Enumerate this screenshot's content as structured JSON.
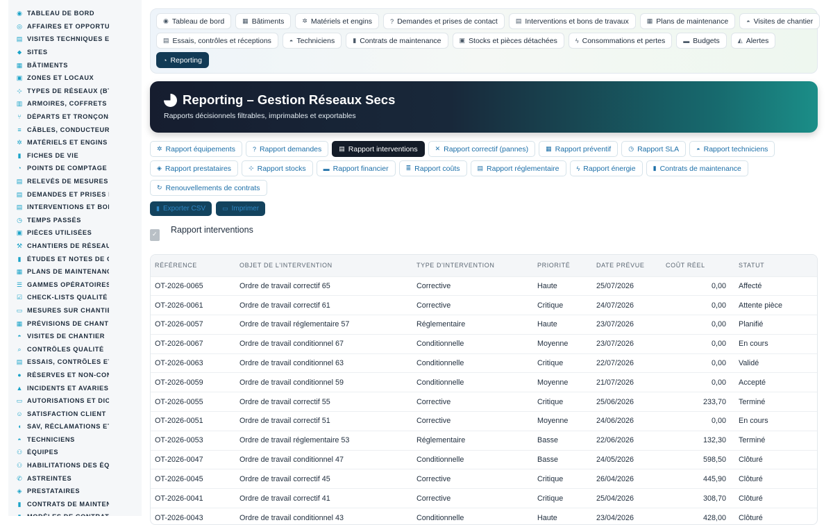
{
  "sidebar": {
    "items": [
      {
        "icon": "dashboard-icon",
        "glyph": "◉",
        "label": "TABLEAU DE BORD"
      },
      {
        "icon": "target-icon",
        "glyph": "◎",
        "label": "AFFAIRES ET OPPORTUNITÉS"
      },
      {
        "icon": "clipboard-icon",
        "glyph": "▤",
        "label": "VISITES TECHNIQUES ET"
      },
      {
        "icon": "location-pin-icon",
        "glyph": "⬥",
        "label": "SITES"
      },
      {
        "icon": "building-icon",
        "glyph": "▦",
        "label": "BÂTIMENTS"
      },
      {
        "icon": "zone-icon",
        "glyph": "▣",
        "label": "ZONES ET LOCAUX"
      },
      {
        "icon": "network-icon",
        "glyph": "⊹",
        "label": "TYPES DE RÉSEAUX (BT / HTA)"
      },
      {
        "icon": "cabinet-icon",
        "glyph": "▥",
        "label": "ARMOIRES, COFFRETS ET"
      },
      {
        "icon": "branch-icon",
        "glyph": "⑂",
        "label": "DÉPARTS ET TRONÇONS"
      },
      {
        "icon": "cable-icon",
        "glyph": "≡",
        "label": "CÂBLES, CONDUCTEURS"
      },
      {
        "icon": "gear-icon",
        "glyph": "✲",
        "label": "MATÉRIELS ET ENGINS"
      },
      {
        "icon": "file-icon",
        "glyph": "▮",
        "label": "FICHES DE VIE"
      },
      {
        "icon": "gauge-icon",
        "glyph": "◔",
        "label": "POINTS DE COMPTAGE ET"
      },
      {
        "icon": "clipboard-check-icon",
        "glyph": "▤",
        "label": "RELEVÉS DE MESURES"
      },
      {
        "icon": "clipboard-icon",
        "glyph": "▤",
        "label": "DEMANDES ET PRISES DE"
      },
      {
        "icon": "clipboard-list-icon",
        "glyph": "▤",
        "label": "INTERVENTIONS ET BONS"
      },
      {
        "icon": "clock-icon",
        "glyph": "◷",
        "label": "TEMPS PASSÉS"
      },
      {
        "icon": "box-icon",
        "glyph": "▣",
        "label": "PIÈCES UTILISÉES"
      },
      {
        "icon": "hammer-icon",
        "glyph": "⚒",
        "label": "CHANTIERS DE RÉSEAUX"
      },
      {
        "icon": "file-lines-icon",
        "glyph": "▮",
        "label": "ÉTUDES ET NOTES DE CALCUL"
      },
      {
        "icon": "calendar-icon",
        "glyph": "▦",
        "label": "PLANS DE MAINTENANCE"
      },
      {
        "icon": "list-icon",
        "glyph": "☰",
        "label": "GAMMES OPÉRATOIRES"
      },
      {
        "icon": "checklist-icon",
        "glyph": "☑",
        "label": "CHECK-LISTS QUALITÉ"
      },
      {
        "icon": "ruler-icon",
        "glyph": "▭",
        "label": "MESURES SUR CHANTIER"
      },
      {
        "icon": "calendar-days-icon",
        "glyph": "▦",
        "label": "PRÉVISIONS DE CHANTIER"
      },
      {
        "icon": "helmet-icon",
        "glyph": "◓",
        "label": "VISITES DE CHANTIER"
      },
      {
        "icon": "search-icon",
        "glyph": "⌕",
        "label": "CONTRÔLES QUALITÉ"
      },
      {
        "icon": "clipboard-check-icon",
        "glyph": "▤",
        "label": "ESSAIS, CONTRÔLES ET"
      },
      {
        "icon": "alert-circle-icon",
        "glyph": "●",
        "label": "RÉSERVES ET NON-CONFORMITÉS"
      },
      {
        "icon": "warning-icon",
        "glyph": "▲",
        "label": "INCIDENTS ET AVARIES"
      },
      {
        "icon": "id-card-icon",
        "glyph": "▭",
        "label": "AUTORISATIONS ET DICT"
      },
      {
        "icon": "smile-icon",
        "glyph": "☺",
        "label": "SATISFACTION CLIENT"
      },
      {
        "icon": "comment-icon",
        "glyph": "◖",
        "label": "SAV, RÉCLAMATIONS ET GARANTIES"
      },
      {
        "icon": "helmet-icon",
        "glyph": "◓",
        "label": "TECHNICIENS"
      },
      {
        "icon": "users-icon",
        "glyph": "⚇",
        "label": "ÉQUIPES"
      },
      {
        "icon": "user-check-icon",
        "glyph": "⚇",
        "label": "HABILITATIONS DES ÉQUIPES"
      },
      {
        "icon": "phone-icon",
        "glyph": "✆",
        "label": "ASTREINTES"
      },
      {
        "icon": "handshake-icon",
        "glyph": "◈",
        "label": "PRESTATAIRES"
      },
      {
        "icon": "file-contract-icon",
        "glyph": "▮",
        "label": "CONTRATS DE MAINTENANCE"
      },
      {
        "icon": "file-icon",
        "glyph": "▮",
        "label": "MODÈLES DE CONTRATS"
      }
    ]
  },
  "topnav": {
    "rows": [
      [
        {
          "icon": "dashboard-icon",
          "glyph": "◉",
          "label": "Tableau de bord"
        },
        {
          "icon": "building-icon",
          "glyph": "▦",
          "label": "Bâtiments"
        },
        {
          "icon": "gear-icon",
          "glyph": "✲",
          "label": "Matériels et engins"
        },
        {
          "icon": "question-icon",
          "glyph": "?",
          "label": "Demandes et prises de contact"
        },
        {
          "icon": "clipboard-icon",
          "glyph": "▤",
          "label": "Interventions et bons de travaux"
        },
        {
          "icon": "calendar-icon",
          "glyph": "▦",
          "label": "Plans de maintenance"
        },
        {
          "icon": "helmet-icon",
          "glyph": "◓",
          "label": "Visites de chantier"
        }
      ],
      [
        {
          "icon": "clipboard-check-icon",
          "glyph": "▤",
          "label": "Essais, contrôles et réceptions"
        },
        {
          "icon": "helmet-icon",
          "glyph": "◓",
          "label": "Techniciens"
        },
        {
          "icon": "file-contract-icon",
          "glyph": "▮",
          "label": "Contrats de maintenance"
        },
        {
          "icon": "boxes-icon",
          "glyph": "▣",
          "label": "Stocks et pièces détachées"
        },
        {
          "icon": "bolt-icon",
          "glyph": "ϟ",
          "label": "Consommations et pertes"
        },
        {
          "icon": "money-icon",
          "glyph": "▬",
          "label": "Budgets"
        },
        {
          "icon": "bell-icon",
          "glyph": "◭",
          "label": "Alertes"
        }
      ],
      [
        {
          "icon": "pie-chart-icon",
          "glyph": "◔",
          "label": "Reporting",
          "active": true
        }
      ]
    ]
  },
  "hero": {
    "title": "Reporting – Gestion Réseaux Secs",
    "subtitle": "Rapports décisionnels filtrables, imprimables et exportables"
  },
  "reports": {
    "rows": [
      [
        {
          "icon": "gears-icon",
          "glyph": "✲",
          "label": "Rapport équipements"
        },
        {
          "icon": "question-icon",
          "glyph": "?",
          "label": "Rapport demandes"
        },
        {
          "icon": "clipboard-icon",
          "glyph": "▤",
          "label": "Rapport interventions",
          "active": true
        },
        {
          "icon": "tools-icon",
          "glyph": "✕",
          "label": "Rapport correctif (pannes)"
        },
        {
          "icon": "calendar-icon",
          "glyph": "▦",
          "label": "Rapport préventif"
        },
        {
          "icon": "stopwatch-icon",
          "glyph": "◷",
          "label": "Rapport SLA"
        },
        {
          "icon": "helmet-icon",
          "glyph": "◓",
          "label": "Rapport techniciens"
        }
      ],
      [
        {
          "icon": "handshake-icon",
          "glyph": "◈",
          "label": "Rapport prestataires"
        },
        {
          "icon": "sitemap-icon",
          "glyph": "⊹",
          "label": "Rapport stocks"
        },
        {
          "icon": "money-icon",
          "glyph": "▬",
          "label": "Rapport financier"
        },
        {
          "icon": "coins-icon",
          "glyph": "≣",
          "label": "Rapport coûts"
        },
        {
          "icon": "clipboard-check-icon",
          "glyph": "▤",
          "label": "Rapport réglementaire"
        },
        {
          "icon": "bolt-icon",
          "glyph": "ϟ",
          "label": "Rapport énergie"
        },
        {
          "icon": "file-contract-icon",
          "glyph": "▮",
          "label": "Contrats de maintenance"
        }
      ],
      [
        {
          "icon": "refresh-icon",
          "glyph": "↻",
          "label": "Renouvellements de contrats"
        }
      ]
    ]
  },
  "actions": {
    "export_label": "Exporter CSV",
    "print_label": "Imprimer"
  },
  "report": {
    "title": "Rapport interventions",
    "columns": [
      "RÉFÉRENCE",
      "OBJET DE L'INTERVENTION",
      "TYPE D'INTERVENTION",
      "PRIORITÉ",
      "DATE PRÉVUE",
      "COÛT RÉEL",
      "STATUT"
    ],
    "rows": [
      [
        "OT-2026-0065",
        "Ordre de travail correctif 65",
        "Corrective",
        "Haute",
        "25/07/2026",
        "0,00",
        "Affecté"
      ],
      [
        "OT-2026-0061",
        "Ordre de travail correctif 61",
        "Corrective",
        "Critique",
        "24/07/2026",
        "0,00",
        "Attente pièce"
      ],
      [
        "OT-2026-0057",
        "Ordre de travail réglementaire 57",
        "Réglementaire",
        "Haute",
        "23/07/2026",
        "0,00",
        "Planifié"
      ],
      [
        "OT-2026-0067",
        "Ordre de travail conditionnel 67",
        "Conditionnelle",
        "Moyenne",
        "23/07/2026",
        "0,00",
        "En cours"
      ],
      [
        "OT-2026-0063",
        "Ordre de travail conditionnel 63",
        "Conditionnelle",
        "Critique",
        "22/07/2026",
        "0,00",
        "Validé"
      ],
      [
        "OT-2026-0059",
        "Ordre de travail conditionnel 59",
        "Conditionnelle",
        "Moyenne",
        "21/07/2026",
        "0,00",
        "Accepté"
      ],
      [
        "OT-2026-0055",
        "Ordre de travail correctif 55",
        "Corrective",
        "Critique",
        "25/06/2026",
        "233,70",
        "Terminé"
      ],
      [
        "OT-2026-0051",
        "Ordre de travail correctif 51",
        "Corrective",
        "Moyenne",
        "24/06/2026",
        "0,00",
        "En cours"
      ],
      [
        "OT-2026-0053",
        "Ordre de travail réglementaire 53",
        "Réglementaire",
        "Basse",
        "22/06/2026",
        "132,30",
        "Terminé"
      ],
      [
        "OT-2026-0047",
        "Ordre de travail conditionnel 47",
        "Conditionnelle",
        "Basse",
        "24/05/2026",
        "598,50",
        "Clôturé"
      ],
      [
        "OT-2026-0045",
        "Ordre de travail correctif 45",
        "Corrective",
        "Critique",
        "26/04/2026",
        "445,90",
        "Clôturé"
      ],
      [
        "OT-2026-0041",
        "Ordre de travail correctif 41",
        "Corrective",
        "Critique",
        "25/04/2026",
        "308,70",
        "Clôturé"
      ],
      [
        "OT-2026-0043",
        "Ordre de travail conditionnel 43",
        "Conditionnelle",
        "Haute",
        "23/04/2026",
        "428,00",
        "Clôturé"
      ]
    ]
  },
  "colors": {
    "accent": "#1aa3c8",
    "link": "#1c6fa8",
    "active_tab": "#141c28",
    "nav_active": "#123a55"
  }
}
